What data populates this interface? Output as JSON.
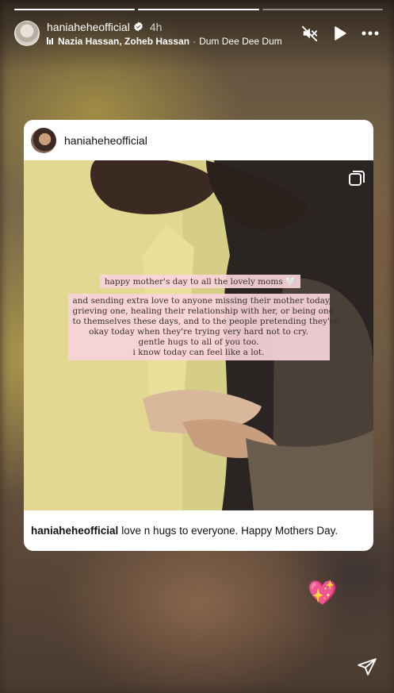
{
  "story": {
    "progress": [
      1.0,
      1.0,
      0.0
    ],
    "user": {
      "username": "haniaheheofficial",
      "time": "4h",
      "verified": true
    },
    "music": {
      "artists": "Nazia Hassan, Zoheb Hassan",
      "separator": "·",
      "song": "Dum Dee Dee Dum"
    },
    "actions": {
      "mute_icon": "speaker-muted-icon",
      "play_icon": "play-icon",
      "more_icon": "more-horizontal-icon"
    }
  },
  "shared_post": {
    "username": "haniaheheofficial",
    "photo_overlay": {
      "headline": "happy mother's day to all the lovely moms 🤍",
      "lines": [
        "and sending extra love to anyone missing their mother today,",
        "grieving one, healing their relationship with her, or being one",
        "to themselves these days, and to the people pretending they're",
        "okay today when they're trying very hard not to cry.",
        "gentle hugs to all of you too.",
        "i know today can feel like a lot."
      ]
    },
    "caption_user": "haniaheheofficial",
    "caption_text": "love n hugs to everyone. Happy Mothers Day."
  },
  "sticker": {
    "emoji": "💖"
  },
  "colors": {
    "overlay_pink": "#f8d4da",
    "verified_blue": "#3897f0"
  }
}
